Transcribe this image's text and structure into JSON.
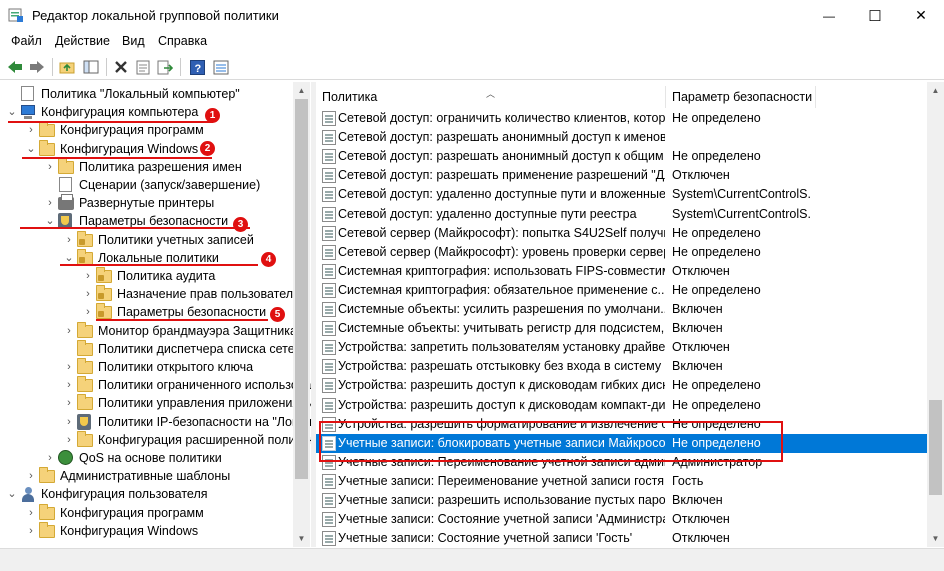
{
  "window": {
    "title": "Редактор локальной групповой политики",
    "minimize_glyph": "—",
    "maximize_glyph": "☐",
    "close_glyph": "✕"
  },
  "menu": [
    "Файл",
    "Действие",
    "Вид",
    "Справка"
  ],
  "toolbar": {
    "icons": [
      "back-icon",
      "forward-icon",
      "up-folder-icon",
      "show-tree-icon",
      "delete-icon",
      "properties-icon",
      "export-icon",
      "help-icon",
      "view-icon"
    ]
  },
  "tree": [
    {
      "label": "Политика \"Локальный компьютер\"",
      "level": 0,
      "expander": "",
      "icon": "doc"
    },
    {
      "label": "Конфигурация компьютера",
      "level": 0,
      "expander": "⌄",
      "icon": "pc"
    },
    {
      "label": "Конфигурация программ",
      "level": 1,
      "expander": "›",
      "icon": "folder"
    },
    {
      "label": "Конфигурация Windows",
      "level": 1,
      "expander": "⌄",
      "icon": "folder"
    },
    {
      "label": "Политика разрешения имен",
      "level": 2,
      "expander": "›",
      "icon": "folder"
    },
    {
      "label": "Сценарии (запуск/завершение)",
      "level": 2,
      "expander": "",
      "icon": "doc"
    },
    {
      "label": "Развернутые принтеры",
      "level": 2,
      "expander": "›",
      "icon": "printer"
    },
    {
      "label": "Параметры безопасности",
      "level": 2,
      "expander": "⌄",
      "icon": "shieldpc"
    },
    {
      "label": "Политики учетных записей",
      "level": 3,
      "expander": "›",
      "icon": "lockfolder"
    },
    {
      "label": "Локальные политики",
      "level": 3,
      "expander": "⌄",
      "icon": "lockfolder"
    },
    {
      "label": "Политика аудита",
      "level": 4,
      "expander": "›",
      "icon": "lockfolder"
    },
    {
      "label": "Назначение прав пользователя",
      "level": 4,
      "expander": "›",
      "icon": "lockfolder"
    },
    {
      "label": "Параметры безопасности",
      "level": 4,
      "expander": "›",
      "icon": "lockfolder"
    },
    {
      "label": "Монитор брандмауэра Защитника",
      "level": 3,
      "expander": "›",
      "icon": "folder"
    },
    {
      "label": "Политики диспетчера списка сетей",
      "level": 3,
      "expander": "",
      "icon": "folder"
    },
    {
      "label": "Политики открытого ключа",
      "level": 3,
      "expander": "›",
      "icon": "folder"
    },
    {
      "label": "Политики ограниченного использования",
      "level": 3,
      "expander": "›",
      "icon": "folder"
    },
    {
      "label": "Политики управления приложениями",
      "level": 3,
      "expander": "›",
      "icon": "folder"
    },
    {
      "label": "Политики IP-безопасности на \"Локальный компьютер\"",
      "level": 3,
      "expander": "›",
      "icon": "shieldpc"
    },
    {
      "label": "Конфигурация расширенной политики аудита",
      "level": 3,
      "expander": "›",
      "icon": "folder"
    },
    {
      "label": "QoS на основе политики",
      "level": 2,
      "expander": "›",
      "icon": "chart"
    },
    {
      "label": "Административные шаблоны",
      "level": 1,
      "expander": "›",
      "icon": "folder"
    },
    {
      "label": "Конфигурация пользователя",
      "level": 0,
      "expander": "⌄",
      "icon": "user"
    },
    {
      "label": "Конфигурация программ",
      "level": 1,
      "expander": "›",
      "icon": "folder"
    },
    {
      "label": "Конфигурация Windows",
      "level": 1,
      "expander": "›",
      "icon": "folder"
    }
  ],
  "annotations": [
    "1",
    "2",
    "3",
    "4",
    "5"
  ],
  "list": {
    "columns": [
      "Политика",
      "Параметр безопасности"
    ],
    "rows": [
      {
        "policy": "Сетевой доступ: ограничить количество клиентов, котор...",
        "value": "Не определено"
      },
      {
        "policy": "Сетевой доступ: разрешать анонимный доступ к именов...",
        "value": ""
      },
      {
        "policy": "Сетевой доступ: разрешать анонимный доступ к общим ...",
        "value": "Не определено"
      },
      {
        "policy": "Сетевой доступ: разрешать применение разрешений \"Дл...",
        "value": "Отключен"
      },
      {
        "policy": "Сетевой доступ: удаленно доступные пути и вложенные ...",
        "value": "System\\CurrentControlS..."
      },
      {
        "policy": "Сетевой доступ: удаленно доступные пути реестра",
        "value": "System\\CurrentControlS..."
      },
      {
        "policy": "Сетевой сервер (Майкрософт): попытка S4U2Self получи...",
        "value": "Не определено"
      },
      {
        "policy": "Сетевой сервер (Майкрософт): уровень проверки сервер...",
        "value": "Не определено"
      },
      {
        "policy": "Системная криптография: использовать FIPS-совместим...",
        "value": "Отключен"
      },
      {
        "policy": "Системная криптография: обязательное применение с...",
        "value": "Не определено"
      },
      {
        "policy": "Системные объекты: усилить разрешения по умолчани...",
        "value": "Включен"
      },
      {
        "policy": "Системные объекты: учитывать регистр для подсистем,...",
        "value": "Включен"
      },
      {
        "policy": "Устройства: запретить пользователям установку драйвер...",
        "value": "Отключен"
      },
      {
        "policy": "Устройства: разрешать отстыковку без входа в систему",
        "value": "Включен"
      },
      {
        "policy": "Устройства: разрешить доступ к дисководам гибких диск...",
        "value": "Не определено"
      },
      {
        "policy": "Устройства: разрешить доступ к дисководам компакт-ди...",
        "value": "Не определено"
      },
      {
        "policy": "Устройства: разрешить форматирование и извлечение съ...",
        "value": "Не определено"
      },
      {
        "policy": "Учетные записи: блокировать учетные записи Майкросо...",
        "value": "Не определено"
      },
      {
        "policy": "Учетные записи: Переименование учетной записи админ...",
        "value": "Администратор"
      },
      {
        "policy": "Учетные записи: Переименование учетной записи гостя",
        "value": "Гость"
      },
      {
        "policy": "Учетные записи: разрешить использование пустых паро...",
        "value": "Включен"
      },
      {
        "policy": "Учетные записи: Состояние учетной записи 'Администра...",
        "value": "Отключен"
      },
      {
        "policy": "Учетные записи: Состояние учетной записи 'Гость'",
        "value": "Отключен"
      }
    ],
    "selected_index": 17
  },
  "colors": {
    "selection": "#0078d7",
    "annotation": "#e01010"
  }
}
